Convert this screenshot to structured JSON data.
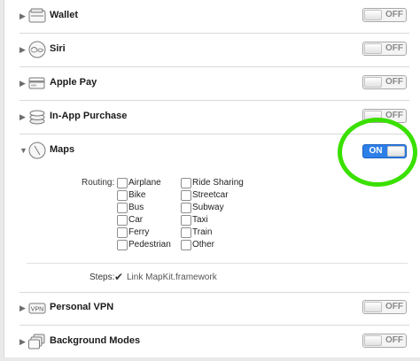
{
  "capabilities": [
    {
      "title": "Wallet",
      "icon": "wallet-icon",
      "toggle": "OFF"
    },
    {
      "title": "Siri",
      "icon": "siri-icon",
      "toggle": "OFF"
    },
    {
      "title": "Apple Pay",
      "icon": "apple-pay-icon",
      "toggle": "OFF"
    },
    {
      "title": "In-App Purchase",
      "icon": "in-app-purchase-icon",
      "toggle": "OFF"
    },
    {
      "title": "Maps",
      "icon": "maps-icon",
      "toggle": "ON"
    },
    {
      "title": "Personal VPN",
      "icon": "personal-vpn-icon",
      "toggle": "OFF"
    },
    {
      "title": "Background Modes",
      "icon": "background-modes-icon",
      "toggle": "OFF"
    }
  ],
  "maps": {
    "routing_label": "Routing:",
    "options_col1": [
      "Airplane",
      "Bike",
      "Bus",
      "Car",
      "Ferry",
      "Pedestrian"
    ],
    "options_col2": [
      "Ride Sharing",
      "Streetcar",
      "Subway",
      "Taxi",
      "Train",
      "Other"
    ],
    "steps_label": "Steps:",
    "step_check": "✔",
    "step_text": "Link MapKit.framework"
  },
  "icons": {
    "disclosure_collapsed": "▶",
    "disclosure_expanded": "▼",
    "vpn_badge": "VPN"
  },
  "colors": {
    "toggle_on": "#2d7fe8",
    "highlight_circle": "#3ae000"
  }
}
